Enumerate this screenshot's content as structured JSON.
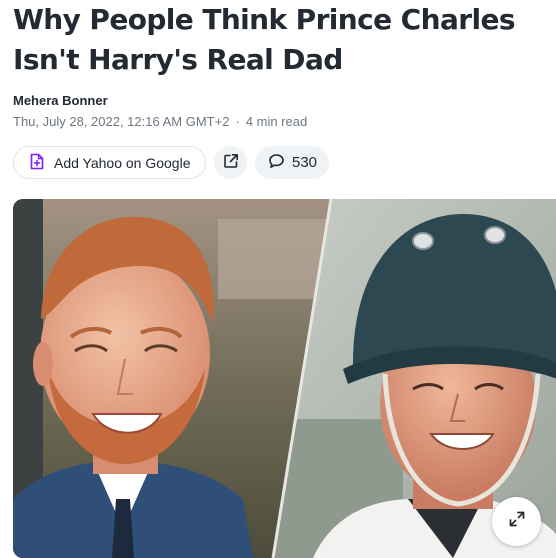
{
  "article": {
    "title": "Why People Think Prince Charles Isn't Harry's Real Dad",
    "author": "Mehera Bonner",
    "date": "Thu, July 28, 2022, 12:16 AM GMT+2",
    "separator": "·",
    "read_time": "4 min read"
  },
  "actions": {
    "add_source_label": "Add Yahoo on Google",
    "comment_count": "530"
  },
  "icons": {
    "add_source": "add-document-icon",
    "share": "share-icon",
    "comments": "speech-bubble-icon",
    "expand": "expand-arrows-icon"
  },
  "colors": {
    "accent_purple": "#7e1fff",
    "text_primary": "#232a31",
    "text_secondary": "#6e7780"
  }
}
